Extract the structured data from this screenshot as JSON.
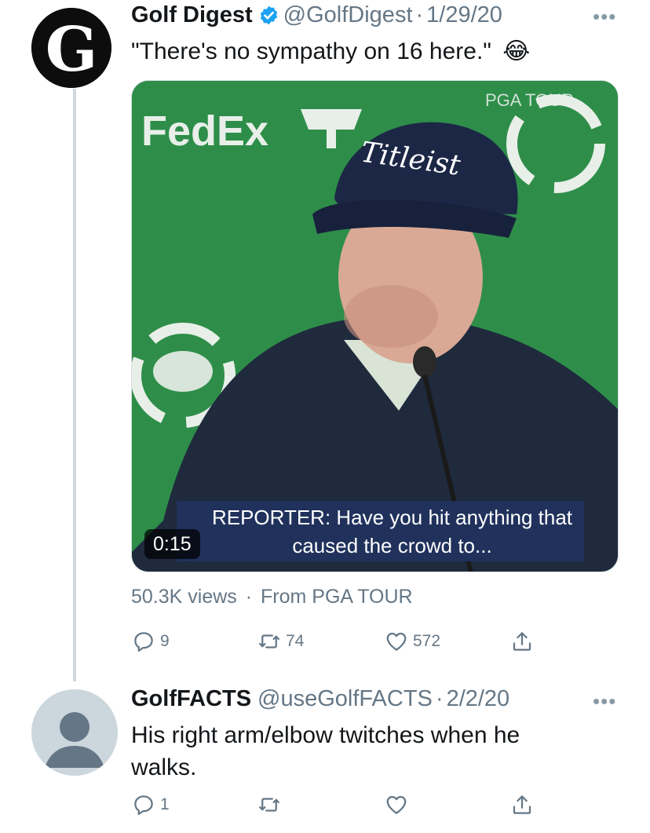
{
  "tweet": {
    "author_name": "Golf Digest",
    "handle": "@GolfDigest",
    "separator": "·",
    "date": "1/29/20",
    "text": "\"There's no sympathy on 16 here.\"",
    "emoji": "😂",
    "avatar_letter": "G",
    "more_label": "•••",
    "video": {
      "brand_text": "FedEx",
      "cap_text": "Titleist",
      "tour_text": "PGA TOUR",
      "duration": "0:15",
      "caption_line1": "REPORTER: Have you hit anything that",
      "caption_line2": "caused the crowd to..."
    },
    "views": "50.3K views",
    "source": "From PGA TOUR",
    "replies": "9",
    "retweets": "74",
    "likes": "572"
  },
  "reply": {
    "author_name": "GolfFACTS",
    "handle": "@useGolfFACTS",
    "separator": "·",
    "date": "2/2/20",
    "text_line1": "His right arm/elbow twitches when he",
    "text_line2": "walks.",
    "more_label": "•••",
    "replies": "1",
    "retweets": "",
    "likes": ""
  },
  "colors": {
    "text": "#14171a",
    "secondary": "#657786",
    "verified": "#1da1f2",
    "thread_line": "#cfd9de",
    "video_green": "#2e8e49",
    "caption_blue": "#21325f"
  },
  "icons": [
    "verified-badge-icon",
    "more-icon",
    "reply-icon",
    "retweet-icon",
    "like-icon",
    "share-icon",
    "default-avatar-icon",
    "laughing-emoji-icon"
  ]
}
